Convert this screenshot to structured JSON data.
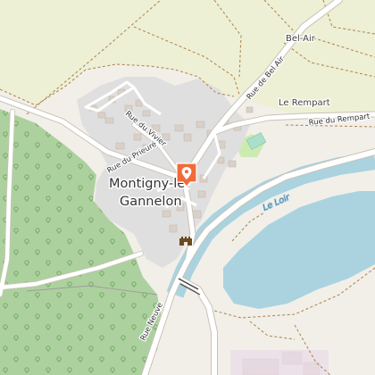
{
  "map": {
    "labels": {
      "town": [
        "Montigny-le-",
        "Gannelon"
      ],
      "bel_air_place": "Bel-Air",
      "rempart_place": "Le Rempart",
      "rue_bel_air": "Rue de Bel Air",
      "rue_rempart": "Rue du Rempart",
      "rue_vivier": "Rue du Vivier",
      "rue_prieure": "Rue du Prieuré",
      "rue_neuve": "Rue Neuve",
      "river": "Le Loir"
    },
    "marker": {
      "icon": "location-pin-icon",
      "color": "#f06a3a"
    },
    "poi": {
      "icon": "castle-icon",
      "color": "#6b4a1f"
    },
    "colors": {
      "farmland": "#eef0d5",
      "forest": "#add19e",
      "residential": "#e0dfdf",
      "water": "#aad3df",
      "road": "#ffffff",
      "track": "#b08a55"
    }
  }
}
